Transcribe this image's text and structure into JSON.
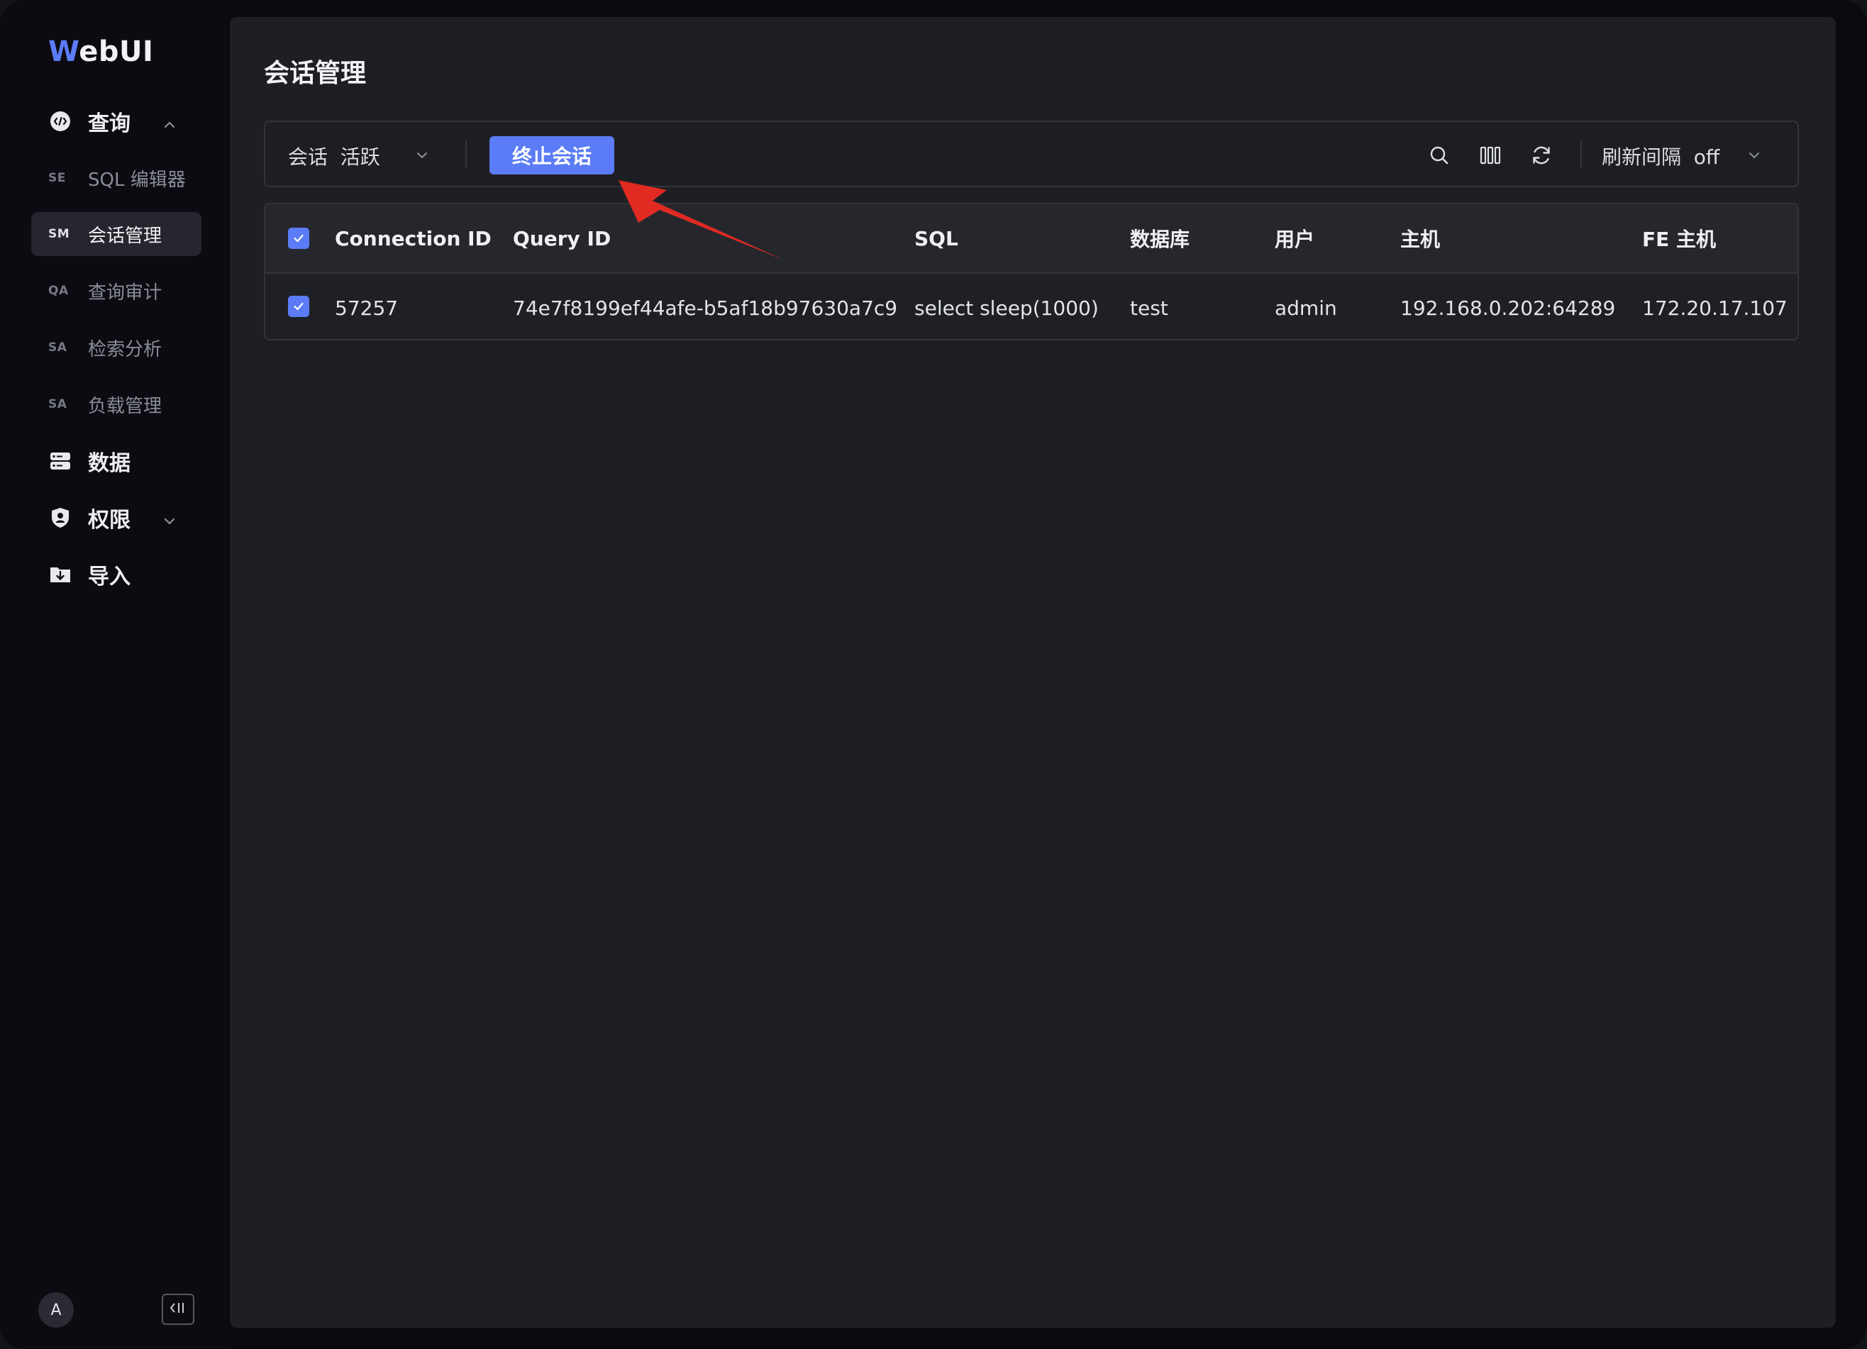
{
  "app": {
    "logo_first": "W",
    "logo_rest": "ebUI"
  },
  "sidebar": {
    "query": {
      "label": "查询"
    },
    "sub_items": [
      {
        "abbr": "SE",
        "label": "SQL 编辑器"
      },
      {
        "abbr": "SM",
        "label": "会话管理",
        "active": true
      },
      {
        "abbr": "QA",
        "label": "查询审计"
      },
      {
        "abbr": "SA",
        "label": "检索分析"
      },
      {
        "abbr": "SA",
        "label": "负载管理"
      }
    ],
    "data": {
      "label": "数据"
    },
    "permissions": {
      "label": "权限"
    },
    "import": {
      "label": "导入"
    },
    "avatar": "A",
    "collapse_icon": "collapse-sidebar-icon"
  },
  "page": {
    "title": "会话管理"
  },
  "toolbar": {
    "session_filter": "会话  活跃",
    "kill_button": "终止会话",
    "refresh_interval": "刷新间隔  off",
    "accent": "#5b7cf6"
  },
  "table": {
    "columns": [
      "Connection ID",
      "Query ID",
      "SQL",
      "数据库",
      "用户",
      "主机",
      "FE 主机"
    ],
    "rows": [
      {
        "connection_id": "57257",
        "query_id": "74e7f8199ef44afe-b5af18b97630a7c9",
        "sql": "select sleep(1000)",
        "database": "test",
        "user": "admin",
        "host": "192.168.0.202:64289",
        "fe_host": "172.20.17.107",
        "checked": true
      }
    ],
    "header_checked": true
  },
  "annotation": {
    "arrow_color": "#e02a22"
  }
}
